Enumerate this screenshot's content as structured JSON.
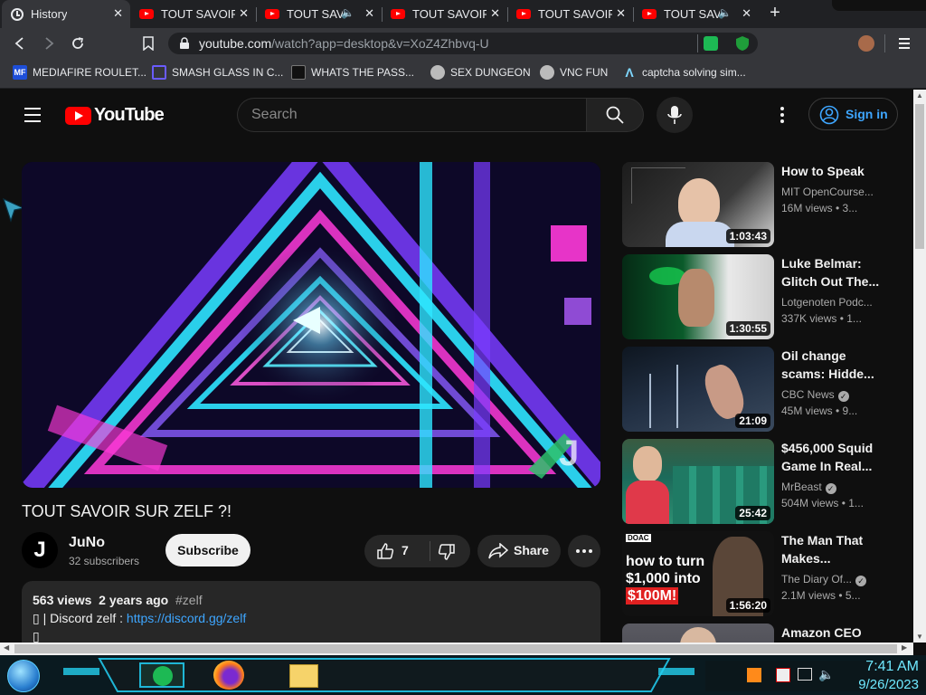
{
  "browser": {
    "tabs": [
      {
        "title": "History",
        "kind": "history"
      },
      {
        "title": "TOUT SAVOIR S",
        "kind": "youtube",
        "audio": false
      },
      {
        "title": "TOUT SAVO",
        "kind": "youtube",
        "audio": true
      },
      {
        "title": "TOUT SAVOIR S",
        "kind": "youtube",
        "audio": false
      },
      {
        "title": "TOUT SAVOIR S",
        "kind": "youtube",
        "audio": false
      },
      {
        "title": "TOUT SAVO",
        "kind": "youtube",
        "audio": true
      }
    ],
    "url_host": "youtube.com",
    "url_path": "/watch?app=desktop&v=XoZ4Zhbvq-U",
    "bookmarks": [
      {
        "label": "MEDIAFIRE ROULET...",
        "icon_text": "MF"
      },
      {
        "label": "SMASH GLASS IN C...",
        "icon_text": ""
      },
      {
        "label": "WHATS THE PASS...",
        "icon_text": ""
      },
      {
        "label": "SEX DUNGEON",
        "icon_text": ""
      },
      {
        "label": "VNC FUN",
        "icon_text": ""
      },
      {
        "label": "captcha solving sim...",
        "icon_text": ""
      }
    ]
  },
  "youtube": {
    "logo": "YouTube",
    "search_placeholder": "Search",
    "signin_label": "Sign in",
    "video": {
      "title": "TOUT SAVOIR SUR ZELF ?!",
      "channel": "JuNo",
      "channel_initial": "J",
      "subscribers": "32 subscribers",
      "subscribe_label": "Subscribe",
      "likes": "7",
      "share_label": "Share",
      "views": "563 views",
      "age": "2 years ago",
      "hashtag": "#zelf",
      "desc_prefix": "▯ | Discord zelf : ",
      "desc_link": "https://discord.gg/zelf",
      "desc_line2": "▯",
      "watermark": "J"
    },
    "recommendations": [
      {
        "title": "How to Speak",
        "channel": "MIT OpenCourse...",
        "verified": false,
        "meta": "16M views  • 3...",
        "duration": "1:03:43",
        "thumb_colors": [
          "#1c1c1c",
          "#d8d8d8"
        ]
      },
      {
        "title": "Luke Belmar: Glitch Out The...",
        "channel": "Lotgenoten Podc...",
        "verified": false,
        "meta": "337K views  • 1...",
        "duration": "1:30:55",
        "thumb_colors": [
          "#0a5a2a",
          "#16c94f"
        ]
      },
      {
        "title": "Oil change scams: Hidde...",
        "channel": "CBC News",
        "verified": true,
        "meta": "45M views  • 9...",
        "duration": "21:09",
        "thumb_colors": [
          "#223044",
          "#7a8aa0"
        ]
      },
      {
        "title": "$456,000 Squid Game In Real...",
        "channel": "MrBeast",
        "verified": true,
        "meta": "504M views  • 1...",
        "duration": "25:42",
        "thumb_colors": [
          "#1c6a5a",
          "#2e8f72"
        ]
      },
      {
        "title": "The Man That Makes...",
        "channel": "The Diary Of...",
        "verified": true,
        "meta": "2.1M views  • 5...",
        "duration": "1:56:20",
        "thumb_colors": [
          "#111111",
          "#e02020"
        ]
      },
      {
        "title": "Amazon CEO",
        "channel": "",
        "verified": false,
        "meta": "",
        "duration": "",
        "thumb_colors": [
          "#3a3a40",
          "#8a8a90"
        ]
      }
    ],
    "thumb_overlay_texts": {
      "doac_badge": "DOAC",
      "doac_line1": "how to turn",
      "doac_line2": "$1,000 into",
      "doac_line3": "$100M!"
    }
  },
  "taskbar": {
    "time": "7:41 AM",
    "date": "9/26/2023"
  },
  "colors": {
    "youtube_red": "#ff0000",
    "link_blue": "#3ea6ff",
    "page_bg": "#0f0f0f",
    "chrome_dark": "#202124",
    "chrome_toolbar": "#35363a",
    "taskbar_clock": "#6fe9ff"
  }
}
